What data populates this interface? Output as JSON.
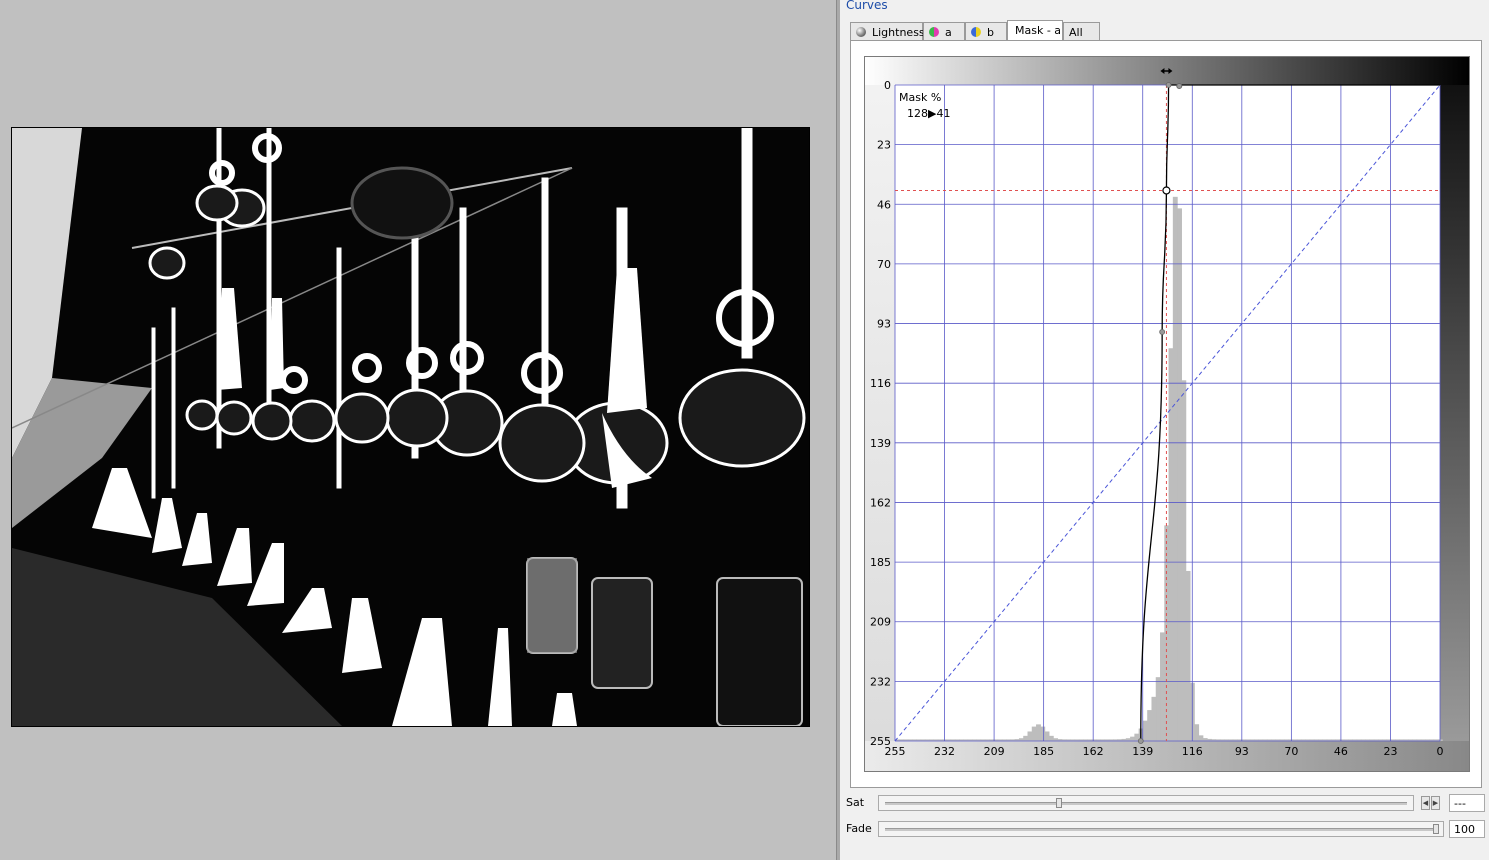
{
  "panel": {
    "title": "Curves"
  },
  "tabs": [
    {
      "label": "Lightness",
      "icon": "lightness-sphere-icon",
      "active": false
    },
    {
      "label": "a",
      "icon": "a-channel-icon",
      "active": false
    },
    {
      "label": "b",
      "icon": "b-channel-icon",
      "active": false
    },
    {
      "label": "Mask - a",
      "icon": "",
      "active": true
    },
    {
      "label": "All",
      "icon": "",
      "active": false
    }
  ],
  "curve": {
    "readout_label": "Mask %",
    "readout_value": "128▶41",
    "y_ticks": [
      "0",
      "23",
      "46",
      "70",
      "93",
      "116",
      "139",
      "162",
      "185",
      "209",
      "232",
      "255"
    ],
    "x_ticks": [
      "255",
      "232",
      "209",
      "185",
      "162",
      "139",
      "116",
      "93",
      "70",
      "46",
      "23",
      "0"
    ],
    "input_max": 255,
    "output_max": 255,
    "selected_point": {
      "input": 128,
      "output": 41
    },
    "control_points": [
      {
        "input": 140,
        "output": 255
      },
      {
        "input": 130,
        "output": 96
      },
      {
        "input": 128,
        "output": 41
      },
      {
        "input": 127,
        "output": 0
      }
    ],
    "top_marker_input": 122,
    "colors": {
      "grid": "#5a5ac8",
      "diagonal": "#4a55d8",
      "guide": "#e05050",
      "histogram": "#bdbdbd",
      "curve": "#000000"
    }
  },
  "sliders": {
    "sat": {
      "label": "Sat",
      "value": "---",
      "position": 0.33
    },
    "fade": {
      "label": "Fade",
      "value": "100",
      "position": 1.0
    }
  }
}
